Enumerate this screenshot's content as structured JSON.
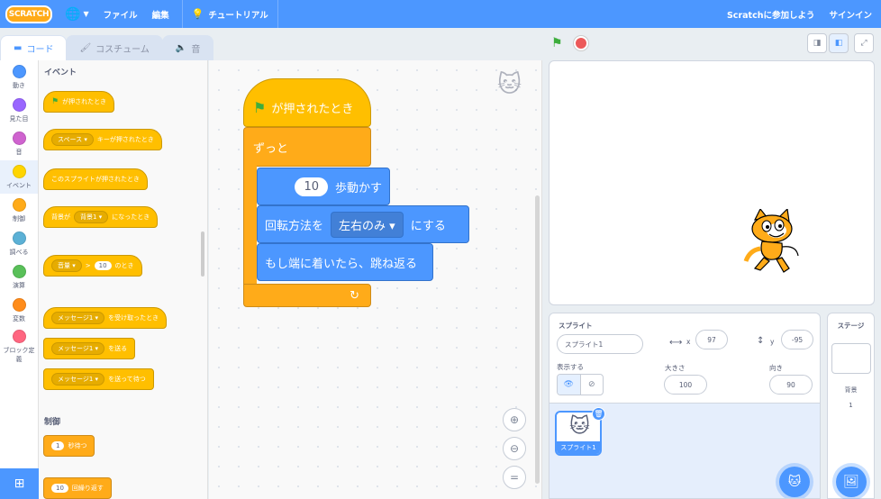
{
  "menubar": {
    "logo": "SCRATCH",
    "file": "ファイル",
    "edit": "編集",
    "tutorial": "チュートリアル",
    "join": "Scratchに参加しよう",
    "signin": "サインイン"
  },
  "tabs": {
    "code": "コード",
    "costumes": "コスチューム",
    "sounds": "音"
  },
  "categories": [
    {
      "label": "動き",
      "color": "#4c97ff"
    },
    {
      "label": "見た目",
      "color": "#9966ff"
    },
    {
      "label": "音",
      "color": "#cf63cf"
    },
    {
      "label": "イベント",
      "color": "#ffd500"
    },
    {
      "label": "制御",
      "color": "#ffab19"
    },
    {
      "label": "調べる",
      "color": "#5cb1d6"
    },
    {
      "label": "演算",
      "color": "#59c059"
    },
    {
      "label": "変数",
      "color": "#ff8c1a"
    },
    {
      "label": "ブロック定義",
      "color": "#ff6680"
    }
  ],
  "palette": {
    "events_title": "イベント",
    "flag_clicked": "が押されたとき",
    "key_key": "スペース",
    "key_tail": "キーが押されたとき",
    "sprite_clicked": "このスプライトが押されたとき",
    "backdrop_head": "背景が",
    "backdrop_drop": "背景1",
    "backdrop_tail": "になったとき",
    "volume_drop": "音量",
    "volume_op": ">",
    "volume_num": "10",
    "volume_tail": "のとき",
    "receive_drop": "メッセージ1",
    "receive_tail": "を受け取ったとき",
    "broadcast_drop": "メッセージ1",
    "broadcast_tail": "を送る",
    "broadcast_wait_drop": "メッセージ1",
    "broadcast_wait_tail": "を送って待つ",
    "control_title": "制御",
    "wait_num": "1",
    "wait_tail": "秒待つ",
    "repeat_num": "10",
    "repeat_tail": "回繰り返す"
  },
  "script": {
    "hat": "が押されたとき",
    "forever": "ずっと",
    "move_num": "10",
    "move_tail": "歩動かす",
    "rotation_head": "回転方法を",
    "rotation_drop": "左右のみ",
    "rotation_tail": "にする",
    "bounce": "もし端に着いたら、跳ね返る",
    "forever_arrow": "↻"
  },
  "sprite_info": {
    "sprite_label": "スプライト",
    "sprite_name": "スプライト1",
    "x_label": "x",
    "x_value": "97",
    "y_label": "y",
    "y_value": "-95",
    "show_label": "表示する",
    "size_label": "大きさ",
    "size_value": "100",
    "direction_label": "向き",
    "direction_value": "90",
    "tile_name": "スプライト1"
  },
  "stage_pane": {
    "title": "ステージ",
    "backdrops_label": "背景",
    "backdrops_count": "1"
  }
}
